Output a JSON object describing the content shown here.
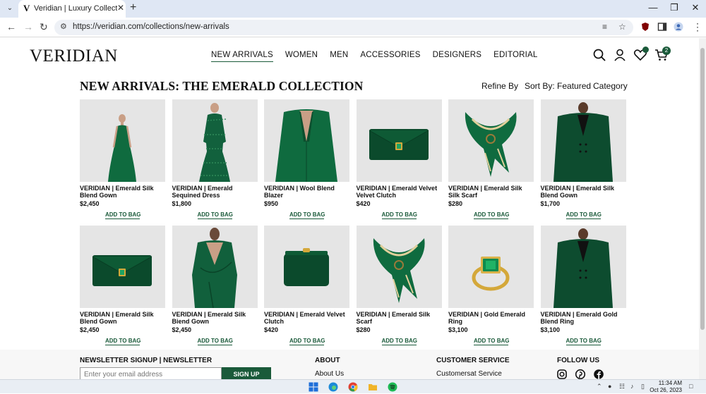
{
  "browser": {
    "tab_title": "Veridian | Luxury Collection | E",
    "tab_favicon": "V",
    "url": "https://veridian.com/collections/new-arrivals"
  },
  "site": {
    "logo": "VERIDIAN",
    "nav": [
      "NEW ARRIVALS",
      "WOMEN",
      "MEN",
      "ACCESSORIES",
      "DESIGNERS",
      "EDITORIAL"
    ],
    "active_nav": "NEW ARRIVALS",
    "cart_count": "2"
  },
  "collection": {
    "title": "NEW ARRIVALS: THE EMERALD COLLECTION",
    "refine": "Refine By",
    "sort": "Sort By: Featured",
    "category": "Category"
  },
  "products": [
    {
      "name": "VERIDIAN | Emerald Silk Blend Gown",
      "price": "$2,450",
      "action": "ADD TO BAG",
      "image": "gown"
    },
    {
      "name": "VERIDIAN | Emerald Sequined Dress",
      "price": "$1,800",
      "action": "ADD TO BAG",
      "image": "sequin-dress"
    },
    {
      "name": "VERIDIAN | Wool Blend Blazer",
      "price": "$950",
      "action": "ADD TO BAG",
      "image": "blazer"
    },
    {
      "name": "VERIDIAN | Emerald Velvet Velvet Clutch",
      "price": "$420",
      "action": "ADD TO BAG",
      "image": "envelope-clutch"
    },
    {
      "name": "VERIDIAN | Emerald Silk Silk Scarf",
      "price": "$280",
      "action": "ADD TO BAG",
      "image": "scarf"
    },
    {
      "name": "VERIDIAN | Emerald Silk Blend Gown",
      "price": "$1,700",
      "action": "ADD TO BAG",
      "image": "suit"
    },
    {
      "name": "VERIDIAN | Emerald Silk Blend Gown",
      "price": "$2,450",
      "action": "ADD TO BAG",
      "image": "envelope-clutch"
    },
    {
      "name": "VERIDIAN | Emerald Silk Biend Gown",
      "price": "$2,450",
      "action": "ADD TO BAG",
      "image": "wrap-dress"
    },
    {
      "name": "VERIDIAN | Emerald Velvet Clutch",
      "price": "$420",
      "action": "ADD TO BAG",
      "image": "frame-clutch"
    },
    {
      "name": "VERIDIAN | Emerald Silk Scarf",
      "price": "$280",
      "action": "ADD TO BAG",
      "image": "scarf"
    },
    {
      "name": "VERIDIAN | Gold Emerald Ring",
      "price": "$3,100",
      "action": "ADD TO BAG",
      "image": "ring"
    },
    {
      "name": "VERIDIAN | Emerald Gold Blend Ring",
      "price": "$3,100",
      "action": "ADD TO BAG",
      "image": "suit"
    }
  ],
  "footer": {
    "newsletter_heading": "NEWSLETTER SIGNUP | NEWSLETTER",
    "email_placeholder": "Enter your email address",
    "signup": "SIGN UP",
    "about_heading": "ABOUT",
    "about_link": "About Us",
    "customer_heading": "CUSTOMER SERVICE",
    "customer_link": "Customersat Service",
    "follow_heading": "FOLLOW US"
  },
  "taskbar": {
    "time": "11:34 AM",
    "date": "Oct 26, 2023"
  },
  "colors": {
    "brand_green": "#1a5a3a",
    "emerald": "#0f6b3f"
  }
}
